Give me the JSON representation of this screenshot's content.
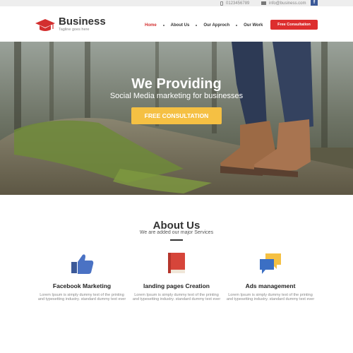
{
  "topbar": {
    "phone": "0123456789",
    "email": "info@business.com",
    "facebook_label": "f"
  },
  "header": {
    "brand": "Business",
    "tagline": "Tagline goes here",
    "nav": [
      {
        "label": "Home",
        "active": true
      },
      {
        "label": "About Us",
        "active": false
      },
      {
        "label": "Our Approch",
        "active": false
      },
      {
        "label": "Our Work",
        "active": false
      }
    ],
    "cta_label": "Free Consultation"
  },
  "hero": {
    "title": "We Providing",
    "subtitle": "Social Media marketing for businesses",
    "button_label": "FREE CONSULTATION"
  },
  "about": {
    "title": "About Us",
    "subtitle": "We are added our major Services",
    "services": [
      {
        "icon": "thumbs-up-icon",
        "title": "Facebook Marketing",
        "description": "Lorem Ipsum is simply dummy text of the printing and typesetting industry. standard dummy text ever"
      },
      {
        "icon": "book-icon",
        "title": "landing pages Creation",
        "description": "Lorem Ipsum is simply dummy text of the printing and typesetting industry. standard dummy text ever"
      },
      {
        "icon": "chat-bubbles-icon",
        "title": "Ads management",
        "description": "Lorem Ipsum is simply dummy text of the printing and typesetting industry. standard dummy text ever"
      }
    ]
  },
  "colors": {
    "accent_red": "#dd2e2e",
    "hero_button": "#f5c043",
    "facebook_blue": "#3b5998"
  }
}
